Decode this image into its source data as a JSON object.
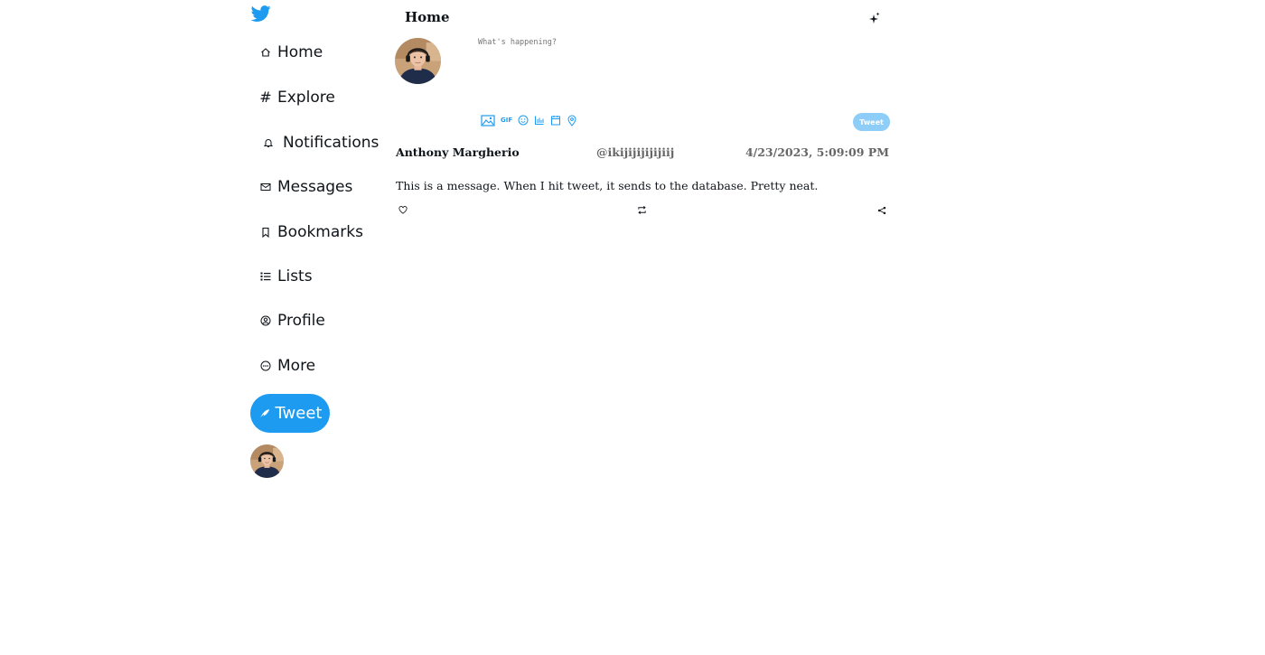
{
  "sidebar": {
    "logo": "twitter-bird-icon",
    "items": [
      {
        "label": "Home",
        "icon": "home-icon"
      },
      {
        "label": "Explore",
        "icon": "hashtag-icon"
      },
      {
        "label": "Notifications",
        "icon": "bell-icon"
      },
      {
        "label": "Messages",
        "icon": "envelope-icon"
      },
      {
        "label": "Bookmarks",
        "icon": "bookmark-icon"
      },
      {
        "label": "Lists",
        "icon": "list-icon"
      },
      {
        "label": "Profile",
        "icon": "user-circle-icon"
      },
      {
        "label": "More",
        "icon": "more-circle-icon"
      }
    ],
    "tweet_button_label": "Tweet"
  },
  "header": {
    "title": "Home",
    "icon": "sparkle-icon"
  },
  "composer": {
    "placeholder": "What's happening?",
    "tools": [
      "image-icon",
      "gif-icon",
      "emoji-icon",
      "poll-icon",
      "schedule-icon",
      "location-icon"
    ],
    "gif_label": "GIF",
    "submit_label": "Tweet"
  },
  "post": {
    "author": "Anthony Margherio",
    "handle": "@ikijijijijijiij",
    "timestamp": "4/23/2023, 5:09:09 PM",
    "text": "This is a message. When I hit tweet, it sends to the database. Pretty neat.",
    "actions": [
      "heart-icon",
      "retweet-icon",
      "share-icon"
    ]
  },
  "colors": {
    "accent": "#1d9bf0",
    "accent_disabled": "#8ecdf8",
    "text_primary": "#0f1419",
    "text_secondary": "#666666"
  }
}
